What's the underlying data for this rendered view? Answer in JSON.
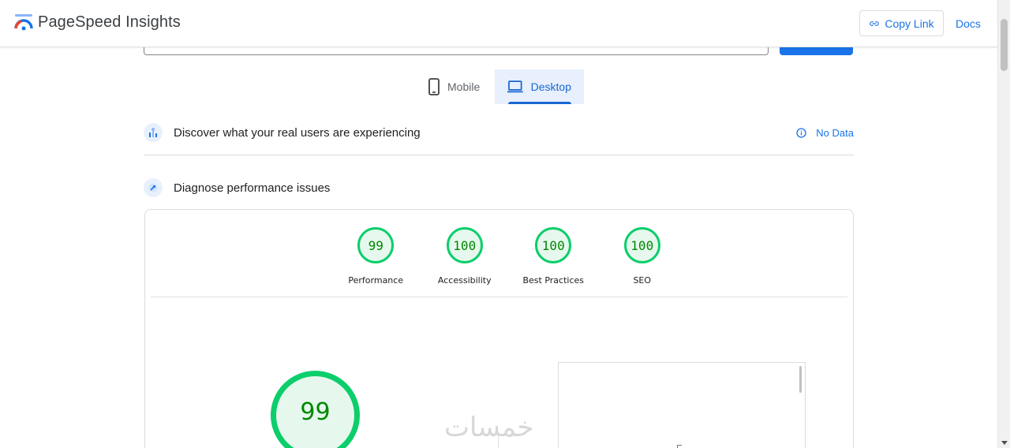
{
  "header": {
    "brand": "PageSpeed Insights",
    "copy_link_label": "Copy Link",
    "docs_label": "Docs"
  },
  "tabs": [
    {
      "label": "Mobile",
      "icon": "phone-icon",
      "selected": false
    },
    {
      "label": "Desktop",
      "icon": "laptop-icon",
      "selected": true
    }
  ],
  "sections": {
    "discover": {
      "title": "Discover what your real users are experiencing",
      "status": "No Data"
    },
    "diagnose": {
      "title": "Diagnose performance issues"
    }
  },
  "scores": [
    {
      "label": "Performance",
      "score": "99"
    },
    {
      "label": "Accessibility",
      "score": "100"
    },
    {
      "label": "Best Practices",
      "score": "100"
    },
    {
      "label": "SEO",
      "score": "100"
    }
  ],
  "main_score": "99",
  "watermark": "خمسات",
  "colors": {
    "accent": "#1a73e8",
    "pass": "#0cce6b",
    "pass_text": "#008800",
    "tab_selected_bg": "#e8f0fe"
  }
}
